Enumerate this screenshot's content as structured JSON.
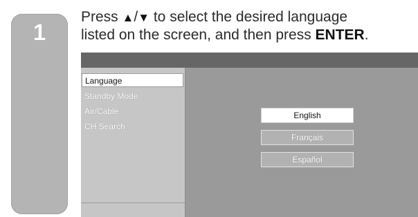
{
  "step": {
    "number": "1"
  },
  "instruction": {
    "line1_prefix": "Press ",
    "up_arrow": "▲",
    "separator": "/",
    "down_arrow": "▼",
    "line1_suffix": " to select the desired language",
    "line2_prefix": "listed on the screen, and then press ",
    "key": "ENTER",
    "line2_suffix": "."
  },
  "menu": {
    "items": [
      {
        "label": "Language",
        "selected": true
      },
      {
        "label": "Standby Mode",
        "selected": false
      },
      {
        "label": "Air/Cable",
        "selected": false
      },
      {
        "label": "CH Search",
        "selected": false
      }
    ]
  },
  "language_options": [
    {
      "label": "English",
      "selected": true
    },
    {
      "label": "Français",
      "selected": false
    },
    {
      "label": "Español",
      "selected": false
    }
  ],
  "colors": {
    "step_tab": "#b4b4b4",
    "screen_background": "#9a9a9a",
    "screen_header": "#666666",
    "menu_panel": "#c6c6c6",
    "highlight": "#ffffff"
  }
}
